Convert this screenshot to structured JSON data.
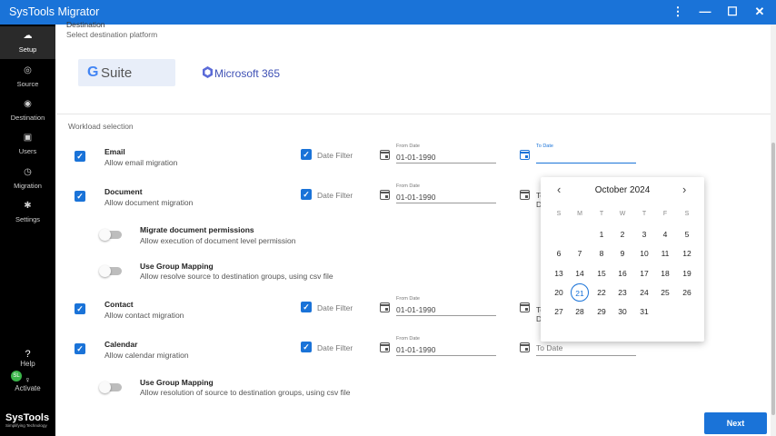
{
  "app": {
    "title": "SysTools Migrator"
  },
  "window_controls": {
    "more": "⋮",
    "minimize": "—",
    "maximize": "☐",
    "close": "✕"
  },
  "sidebar": {
    "items": [
      {
        "label": "Setup",
        "icon": "cloud-icon"
      },
      {
        "label": "Source",
        "icon": "source-icon"
      },
      {
        "label": "Destination",
        "icon": "destination-icon"
      },
      {
        "label": "Users",
        "icon": "users-icon"
      },
      {
        "label": "Migration",
        "icon": "migration-icon"
      },
      {
        "label": "Settings",
        "icon": "gear-icon"
      }
    ],
    "help_icon": "?",
    "help": "Help",
    "activate": "Activate",
    "badge": "SL",
    "logo": "SysTools",
    "logo_tag": "Simplifying Technology"
  },
  "destination": {
    "heading": "Destination",
    "subtitle": "Select destination platform",
    "gsuite_g": "G",
    "gsuite_suite": "Suite",
    "ms365": "Microsoft 365"
  },
  "workload": {
    "heading": "Workload selection",
    "date_filter_label": "Date Filter",
    "from_label": "From Date",
    "to_label": "To Date",
    "rows": [
      {
        "name": "Email",
        "desc": "Allow email migration",
        "from": "01-01-1990",
        "to": ""
      },
      {
        "name": "Document",
        "desc": "Allow document migration",
        "from": "01-01-1990",
        "to": "To Date"
      },
      {
        "name": "Contact",
        "desc": "Allow contact migration",
        "from": "01-01-1990",
        "to": "To Date"
      },
      {
        "name": "Calendar",
        "desc": "Allow calendar migration",
        "from": "01-01-1990",
        "to": "To Date"
      }
    ],
    "options": [
      {
        "name": "Migrate document permissions",
        "desc": "Allow execution of document level permission"
      },
      {
        "name": "Use Group Mapping",
        "desc": "Allow resolve source to destination groups, using csv file"
      },
      {
        "name": "Use Group Mapping",
        "desc": "Allow resolution of source to destination groups, using csv file"
      }
    ]
  },
  "datepicker": {
    "month": "October 2024",
    "prev": "‹",
    "next": "›",
    "weekdays": [
      "S",
      "M",
      "T",
      "W",
      "T",
      "F",
      "S"
    ],
    "days": [
      [
        "",
        "",
        "1",
        "2",
        "3",
        "4",
        "5"
      ],
      [
        "6",
        "7",
        "8",
        "9",
        "10",
        "11",
        "12"
      ],
      [
        "13",
        "14",
        "15",
        "16",
        "17",
        "18",
        "19"
      ],
      [
        "20",
        "21",
        "22",
        "23",
        "24",
        "25",
        "26"
      ],
      [
        "27",
        "28",
        "29",
        "30",
        "31",
        "",
        ""
      ]
    ],
    "today": "21"
  },
  "footer": {
    "next_label": "Next"
  },
  "colors": {
    "accent": "#1a73d8",
    "sidebar": "#000000"
  }
}
